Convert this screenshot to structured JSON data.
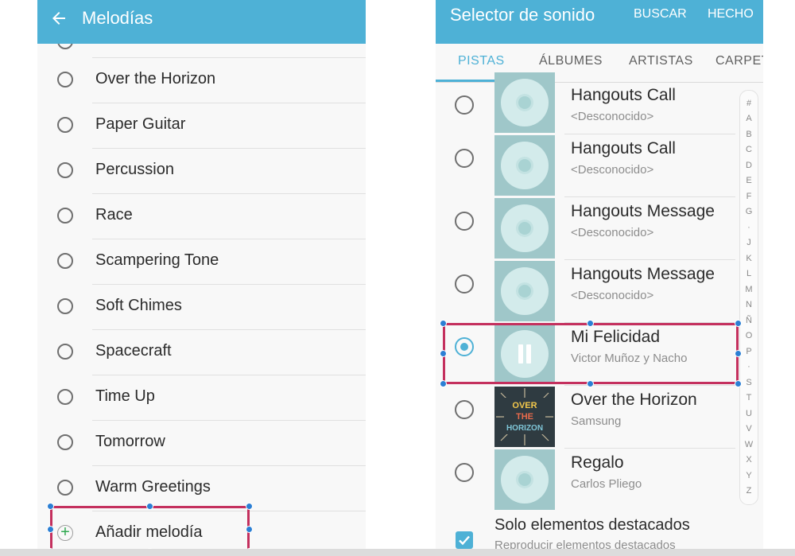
{
  "left": {
    "title": "Melodías",
    "items": [
      {
        "label": "Over the Horizon"
      },
      {
        "label": "Paper Guitar"
      },
      {
        "label": "Percussion"
      },
      {
        "label": "Race"
      },
      {
        "label": "Scampering Tone"
      },
      {
        "label": "Soft Chimes"
      },
      {
        "label": "Spacecraft"
      },
      {
        "label": "Time Up"
      },
      {
        "label": "Tomorrow"
      },
      {
        "label": "Warm Greetings"
      }
    ],
    "add_label": "Añadir melodía"
  },
  "right": {
    "title": "Selector de sonido",
    "search_label": "BUSCAR",
    "done_label": "HECHO",
    "tabs": [
      "PISTAS",
      "ÁLBUMES",
      "ARTISTAS",
      "CARPETAS"
    ],
    "active_tab": "PISTAS",
    "tracks": [
      {
        "title": "Hangouts Call",
        "subtitle": "<Desconocido>",
        "selected": false
      },
      {
        "title": "Hangouts Call",
        "subtitle": "<Desconocido>",
        "selected": false
      },
      {
        "title": "Hangouts Message",
        "subtitle": "<Desconocido>",
        "selected": false
      },
      {
        "title": "Hangouts Message",
        "subtitle": "<Desconocido>",
        "selected": false
      },
      {
        "title": "Mi Felicidad",
        "subtitle": "Victor Muñoz y Nacho",
        "selected": true,
        "playing": true
      },
      {
        "title": "Over the Horizon",
        "subtitle": "Samsung",
        "selected": false
      },
      {
        "title": "Regalo",
        "subtitle": "Carlos Pliego",
        "selected": false
      }
    ],
    "album_art_text": [
      "OVER",
      "THE",
      "HORIZON"
    ],
    "index_letters": [
      "#",
      "A",
      "B",
      "C",
      "D",
      "E",
      "F",
      "G",
      "·",
      "J",
      "K",
      "L",
      "M",
      "N",
      "Ñ",
      "O",
      "P",
      "·",
      "S",
      "T",
      "U",
      "V",
      "W",
      "X",
      "Y",
      "Z"
    ],
    "footer": {
      "title": "Solo elementos destacados",
      "subtitle": "Reproducir elementos destacados",
      "checked": true
    }
  },
  "colors": {
    "accent": "#4eb1d6",
    "selection": "#c4305e",
    "handle": "#2b7fd4",
    "add_icon": "#2fa84f"
  }
}
